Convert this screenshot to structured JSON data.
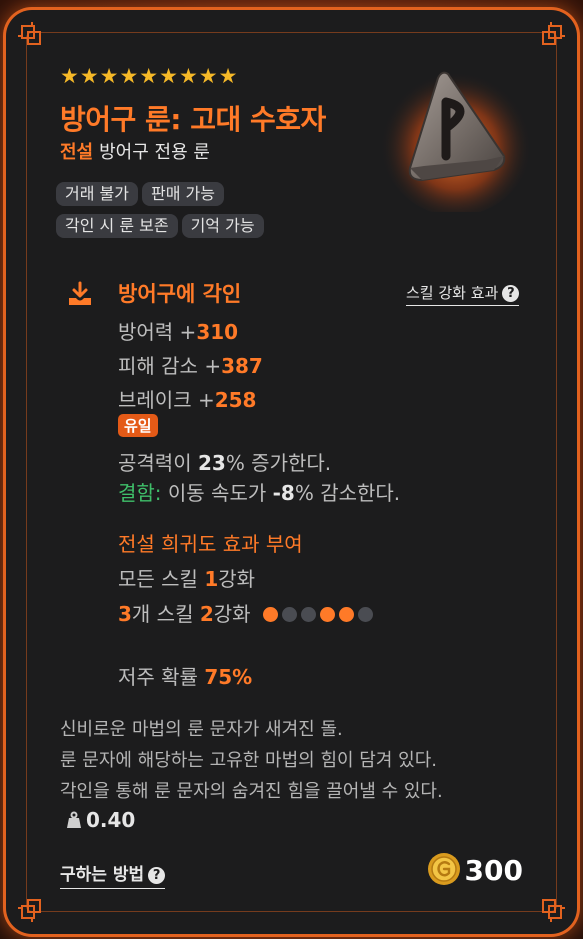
{
  "item": {
    "stars": "★★★★★★★★★",
    "name": "방어구 룬: 고대 수호자",
    "rarity": "전설",
    "type": "방어구 전용 룬",
    "icon": "rune-stone-icon"
  },
  "tags": [
    "거래 불가",
    "판매 가능",
    "각인 시 룬 보존",
    "기억 가능"
  ],
  "engrave": {
    "title": "방어구에 각인",
    "skill_link": "스킬 강화 효과",
    "stats": [
      {
        "label": "방어력 +",
        "value": "310"
      },
      {
        "label": "피해 감소 +",
        "value": "387"
      },
      {
        "label": "브레이크 +",
        "value": "258"
      }
    ],
    "unique_badge": "유일",
    "effect_pre": "공격력이 ",
    "effect_val": "23",
    "effect_post": "% 증가한다.",
    "flaw_label": "결함:",
    "flaw_pre": " 이동 속도가 ",
    "flaw_val": "-8",
    "flaw_post": "% 감소한다."
  },
  "legend_bonus": {
    "title": "전설 희귀도 효과 부여",
    "line1_pre": "모든 스킬 ",
    "line1_val": "1",
    "line1_post": "강화",
    "line2_val1": "3",
    "line2_mid": "개 스킬 ",
    "line2_val2": "2",
    "line2_post": "강화",
    "dots": [
      1,
      0,
      0,
      1,
      1,
      0
    ]
  },
  "curse": {
    "label": "저주 확률 ",
    "value": "75%"
  },
  "lore": [
    "신비로운 마법의 룬 문자가 새겨진 돌.",
    "룬 문자에 해당하는 고유한 마법의 힘이 담겨 있다.",
    "각인을 통해 룬 문자의 숨겨진 힘을 끌어낼 수 있다."
  ],
  "weight": "0.40",
  "howto": "구하는 방법",
  "price": "300",
  "colors": {
    "accent": "#ff7a28",
    "set_green": "#3fbf6a",
    "star": "#f6b928",
    "card_bg": "#1c1c1d"
  }
}
